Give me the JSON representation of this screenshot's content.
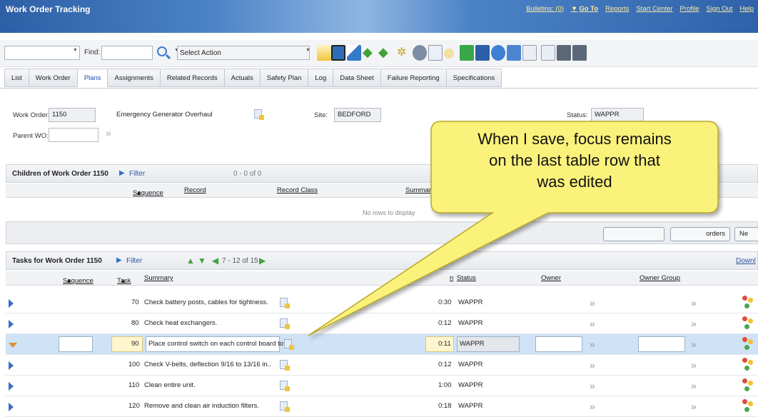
{
  "header": {
    "app_title": "Work Order Tracking",
    "links": [
      "Bulletins: (0)",
      "Go To",
      "Reports",
      "Start Center",
      "Profile",
      "Sign Out",
      "Help"
    ]
  },
  "toolbar": {
    "find_label": "Find:",
    "action_label": "Select Action"
  },
  "tabs": [
    "List",
    "Work Order",
    "Plans",
    "Assignments",
    "Related Records",
    "Actuals",
    "Safety Plan",
    "Log",
    "Data Sheet",
    "Failure Reporting",
    "Specifications"
  ],
  "active_tab": "Plans",
  "form": {
    "work_order_label": "Work Order:",
    "work_order_value": "1150",
    "description_value": "Emergency Generator Overhaul",
    "site_label": "Site:",
    "site_value": "BEDFORD",
    "status_label": "Status:",
    "status_value": "WAPPR",
    "parent_label": "Parent WO:"
  },
  "children": {
    "title": "Children of Work Order 1150",
    "filter_label": "Filter",
    "count": "0 - 0 of 0",
    "columns": [
      "Sequence",
      "Record",
      "Record Class",
      "Summary"
    ],
    "empty_text": "No rows to display",
    "buttons": [
      "orders",
      "Ne"
    ]
  },
  "tasks": {
    "title": "Tasks for Work Order 1150",
    "filter_label": "Filter",
    "count": "7 - 12 of 15",
    "download_label": "Downl",
    "columns": {
      "sequence": "Sequence",
      "task": "Task",
      "summary": "Summary",
      "duration": "n",
      "status": "Status",
      "owner": "Owner",
      "owner_group": "Owner Group"
    },
    "rows": [
      {
        "task": "70",
        "summary": "Check battery posts, cables for tightness.",
        "duration": "0:30",
        "status": "WAPPR"
      },
      {
        "task": "80",
        "summary": "Check heat exchangers.",
        "duration": "0:12",
        "status": "WAPPR"
      },
      {
        "task": "90",
        "summary": "Place control switch on each control board to",
        "duration": "0:11",
        "status": "WAPPR"
      },
      {
        "task": "100",
        "summary": "Check V-belts, deflection 9/16 to 13/16 in..",
        "duration": "0:12",
        "status": "WAPPR"
      },
      {
        "task": "110",
        "summary": "Clean entire unit.",
        "duration": "1:00",
        "status": "WAPPR"
      },
      {
        "task": "120",
        "summary": "Remove and clean air induction filters.",
        "duration": "0:18",
        "status": "WAPPR"
      }
    ]
  },
  "callout": {
    "lines": [
      "When I save, focus remains",
      "on the last table row that",
      "was edited"
    ]
  },
  "colors": {
    "header_blue": "#2d5fa6",
    "callout_fill": "#fbf27c",
    "selected_row": "#cfe2f6"
  }
}
